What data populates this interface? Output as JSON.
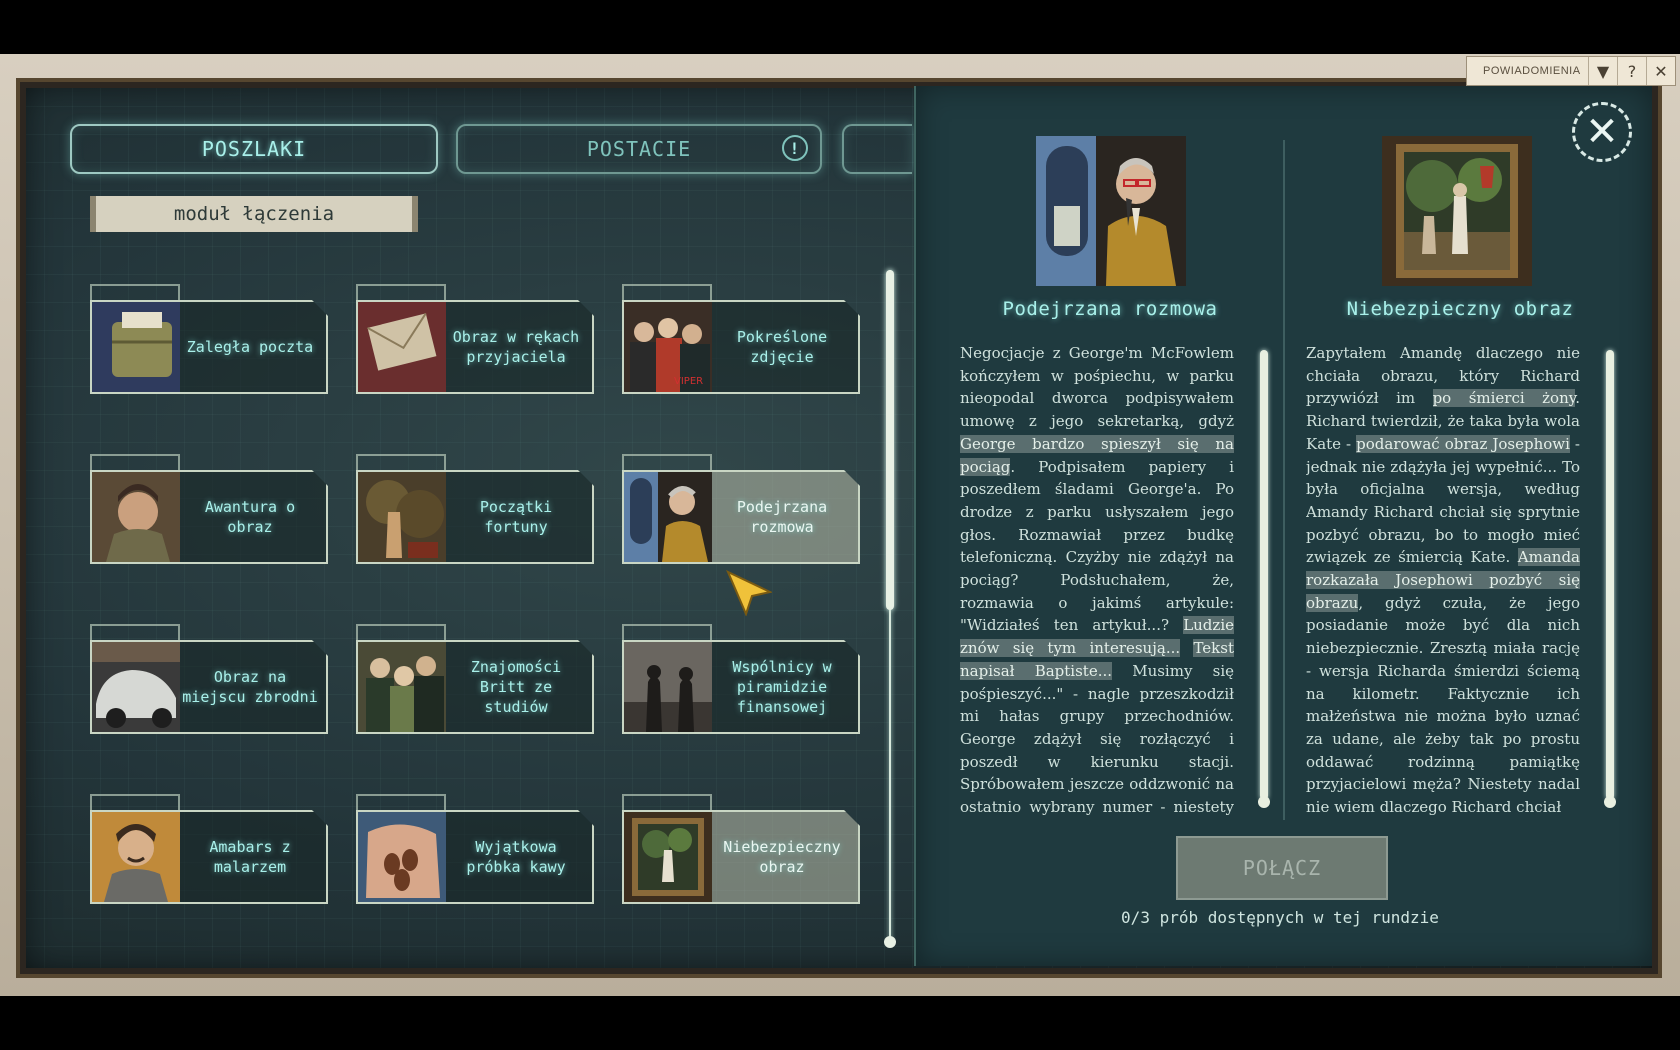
{
  "notifications": {
    "label": "POWIADOMIENIA",
    "dropdown_icon": "▼",
    "help_icon": "?",
    "close_icon": "✕"
  },
  "tabs": [
    {
      "label": "POSZLAKI",
      "active": true
    },
    {
      "label": "POSTACIE",
      "active": false,
      "alert_icon": "!"
    }
  ],
  "module_label": "moduł łączenia",
  "clues": [
    {
      "label": "Zaległa poczta",
      "art": "mailbag"
    },
    {
      "label": "Obraz w rękach przyjaciela",
      "art": "envelope"
    },
    {
      "label": "Pokreślone zdjęcie",
      "art": "crowd"
    },
    {
      "label": "Awantura o obraz",
      "art": "woman"
    },
    {
      "label": "Początki fortuny",
      "art": "painting"
    },
    {
      "label": "Podejrzana rozmowa",
      "art": "phone",
      "selected": true
    },
    {
      "label": "Obraz na miejscu zbrodni",
      "art": "car"
    },
    {
      "label": "Znajomości Britt ze studiów",
      "art": "group"
    },
    {
      "label": "Wspólnicy w piramidzie finansowej",
      "art": "silhouettes"
    },
    {
      "label": "Amabars z malarzem",
      "art": "man"
    },
    {
      "label": "Wyjątkowa próbka kawy",
      "art": "coffee"
    },
    {
      "label": "Niebezpieczny obraz",
      "art": "framed",
      "selected": true
    }
  ],
  "detail": {
    "close_icon": "✕",
    "left": {
      "title": "Podejrzana rozmowa",
      "segments": [
        {
          "t": "Negocjacje z George'm McFowlem kończyłem w pośpiechu, w parku nieopodal dworca podpisywałem umowę z jego sekretarką, gdyż "
        },
        {
          "t": "George bardzo spieszył się na pociąg",
          "hl": true
        },
        {
          "t": ". Podpisałem papiery i poszedłem śladami George'a. Po drodze z parku usłyszałem jego głos. Rozmawiał przez budkę telefoniczną. Czyżby nie zdążył na pociąg? Podsłuchałem, że, rozmawia o jakimś artykule: \"Widziałeś ten artykuł...? "
        },
        {
          "t": "Ludzie znów się tym interesują...",
          "hl": true
        },
        {
          "t": " "
        },
        {
          "t": "Tekst napisał Baptiste...",
          "hl": true
        },
        {
          "t": " Musimy się pośpieszyć...\" - nagle przeszkodził mi hałas grupy przechodniów. George zdążył się rozłączyć i poszedł w kierunku stacji. Spróbowałem jeszcze oddzwonić na ostatnio wybrany numer - niestety rozmówca George'a już nie podniósł"
        }
      ]
    },
    "right": {
      "title": "Niebezpieczny obraz",
      "segments": [
        {
          "t": "Zapytałem Amandę dlaczego nie chciała obrazu, który Richard przywiózł im "
        },
        {
          "t": "po śmierci żony",
          "hl": true
        },
        {
          "t": ". Richard twierdził, że taka była wola Kate - "
        },
        {
          "t": "podarować obraz Josephowi",
          "hl": true
        },
        {
          "t": " - jednak nie zdążyła jej wypełnić... To była oficjalna wersja, według Amandy Richard chciał się sprytnie pozbyć obrazu, bo to mogło mieć związek ze śmiercią Kate. "
        },
        {
          "t": "Amanda rozkazała Josephowi pozbyć się obrazu",
          "hl": true
        },
        {
          "t": ", gdyż czuła, że jego posiadanie może być dla nich niebezpiecznie. Zresztą miała rację - wersja Richarda śmierdzi ściemą na kilometr. Faktycznie ich małżeństwa nie można było uznać za udane, ale żeby tak po prostu oddawać rodzinną pamiątkę przyjacielowi męża? Niestety nadal nie wiem dlaczego Richard chciał"
        }
      ]
    },
    "connect_label": "POŁĄCZ",
    "attempts_text": "0/3 prób dostępnych w tej rundzie"
  }
}
